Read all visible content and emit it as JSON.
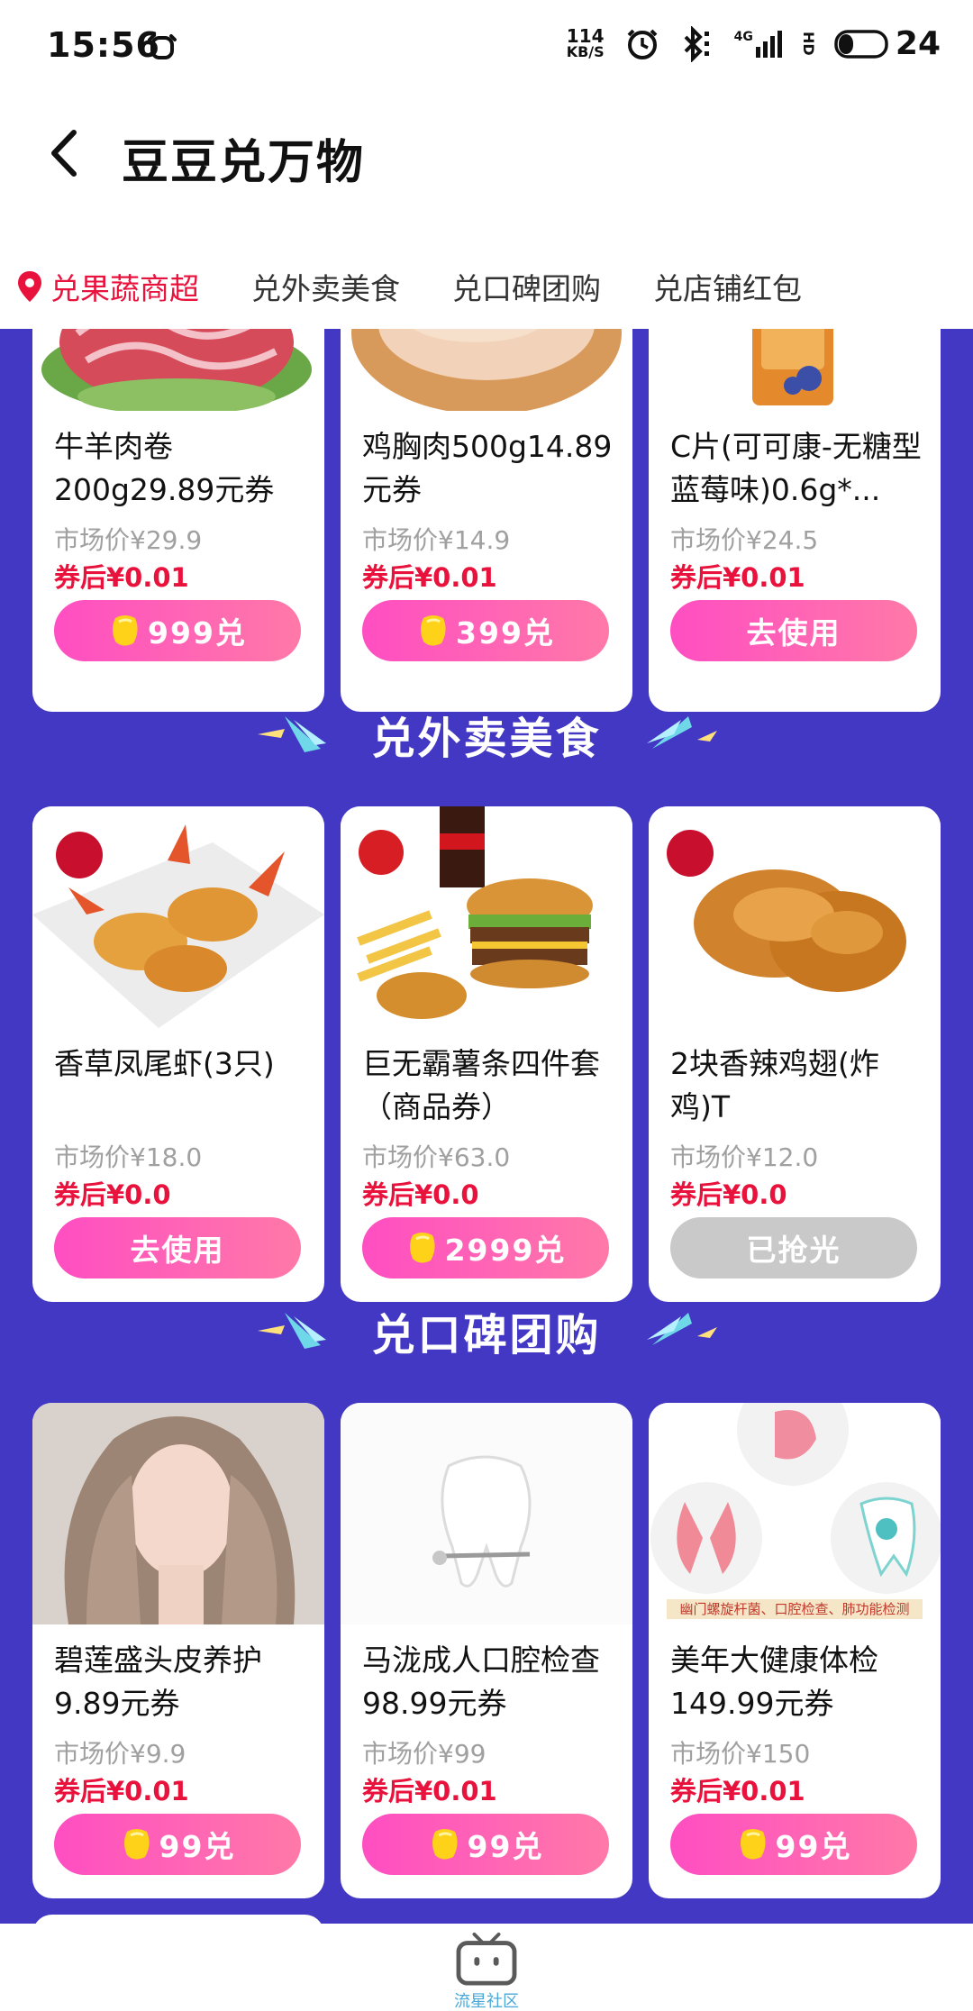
{
  "status": {
    "time": "15:56",
    "net_speed_value": "114",
    "net_speed_unit": "KB/S",
    "signal_label": "4G",
    "hd_label": "HD",
    "battery": "24"
  },
  "header": {
    "title": "豆豆兑万物"
  },
  "tabs": [
    {
      "label": "兑果蔬商超"
    },
    {
      "label": "兑外卖美食"
    },
    {
      "label": "兑口碑团购"
    },
    {
      "label": "兑店铺红包"
    }
  ],
  "sections": {
    "food": "兑外卖美食",
    "groupbuy": "兑口碑团购"
  },
  "row1": [
    {
      "name": "牛羊肉卷200g29.89元券",
      "market": "市场价¥29.9",
      "after": "券后¥0.01",
      "button": "999兑",
      "coin": true
    },
    {
      "name": "鸡胸肉500g14.89元券",
      "market": "市场价¥14.9",
      "after": "券后¥0.01",
      "button": "399兑",
      "coin": true
    },
    {
      "name": "C片(可可康-无糖型蓝莓味)0.6g*...",
      "market": "市场价¥24.5",
      "after": "券后¥0.01",
      "button": "去使用",
      "coin": false
    }
  ],
  "row2": [
    {
      "name": "香草凤尾虾(3只)",
      "market": "市场价¥18.0",
      "after": "券后¥0.0",
      "button": "去使用",
      "coin": false
    },
    {
      "name": "巨无霸薯条四件套（商品券）",
      "market": "市场价¥63.0",
      "after": "券后¥0.0",
      "button": "2999兑",
      "coin": true
    },
    {
      "name": "2块香辣鸡翅(炸鸡)T",
      "market": "市场价¥12.0",
      "after": "券后¥0.0",
      "button": "已抢光",
      "coin": false,
      "disabled": true
    }
  ],
  "row3": [
    {
      "name": "碧莲盛头皮养护9.89元券",
      "market": "市场价¥9.9",
      "after": "券后¥0.01",
      "button": "99兑",
      "coin": true
    },
    {
      "name": "马泷成人口腔检查98.99元券",
      "market": "市场价¥99",
      "after": "券后¥0.01",
      "button": "99兑",
      "coin": true
    },
    {
      "name": "美年大健康体检149.99元券",
      "market": "市场价¥150",
      "after": "券后¥0.01",
      "button": "99兑",
      "coin": true,
      "banner": "幽门螺旋杆菌、口腔检查、肺功能检测"
    }
  ],
  "bottom_nav": {
    "label": "流星社区"
  },
  "colors": {
    "accent": "#e8123c",
    "background_purple": "#4338c4",
    "button_gradient_start": "#ff4ec2",
    "button_gradient_end": "#ff79a8"
  }
}
